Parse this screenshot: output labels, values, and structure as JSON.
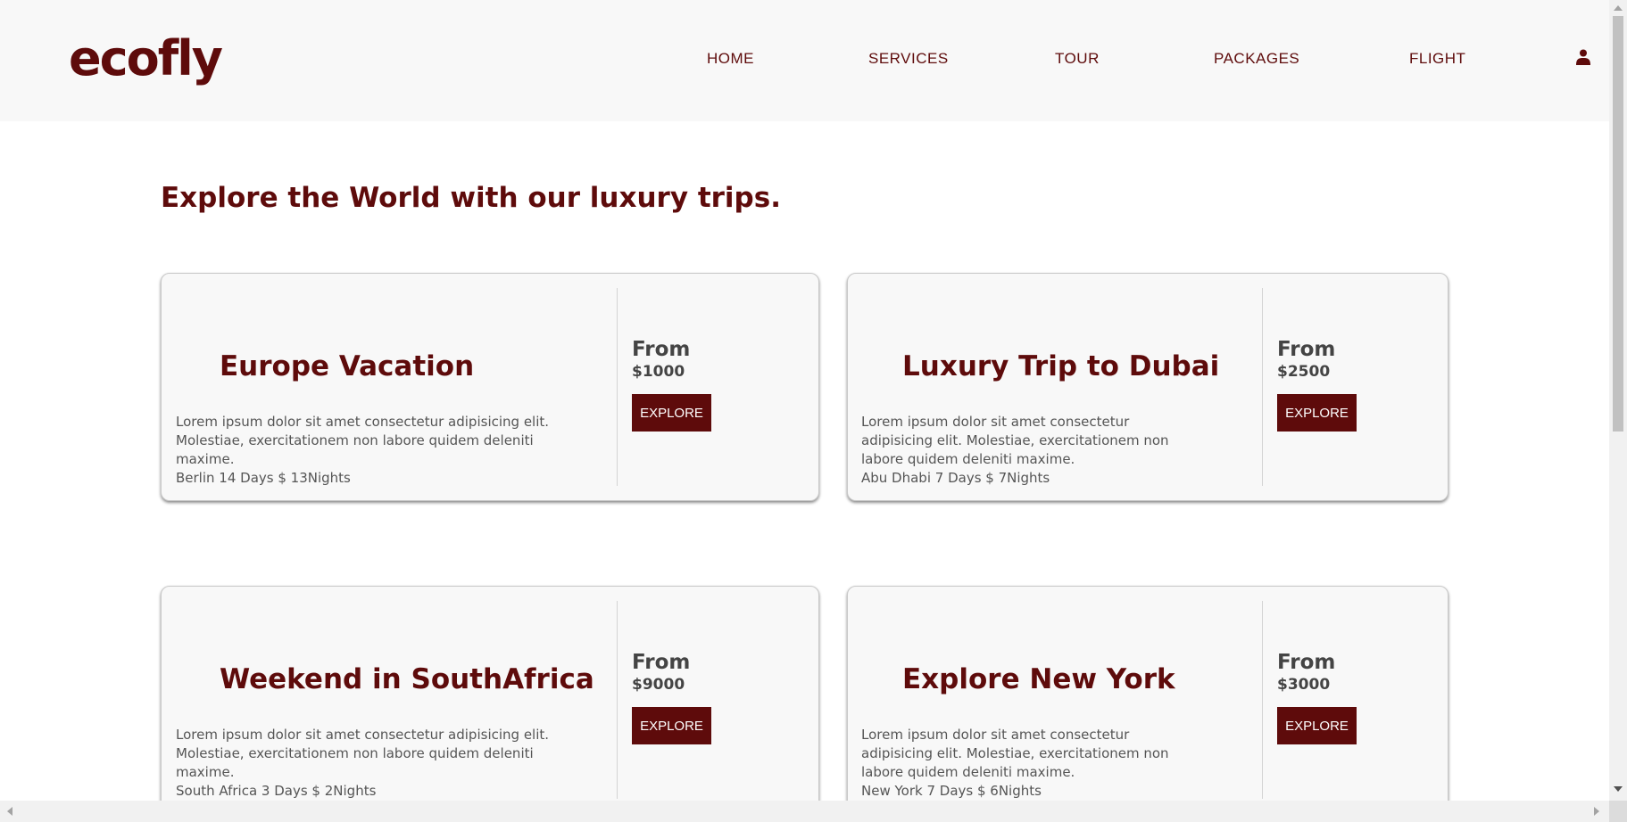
{
  "brand": {
    "logo": "ecofly"
  },
  "nav": {
    "items": [
      {
        "label": "HOME"
      },
      {
        "label": "SERVICES"
      },
      {
        "label": "TOUR"
      },
      {
        "label": "PACKAGES"
      },
      {
        "label": "FLIGHT"
      }
    ],
    "user_icon": "user-icon"
  },
  "main": {
    "title": "Explore the World with our luxury trips."
  },
  "trips": [
    {
      "title": "Europe Vacation",
      "desc_lines": [
        "Lorem ipsum dolor sit amet consectetur adipisicing elit.",
        "Molestiae, exercitationem non labore quidem deleniti",
        "maxime."
      ],
      "meta": "Berlin 14 Days $ 13Nights",
      "from_label": "From",
      "price": "$1000",
      "button": "EXPLORE"
    },
    {
      "title": "Luxury Trip to Dubai",
      "desc_lines": [
        "Lorem ipsum dolor sit amet consectetur",
        "adipisicing elit. Molestiae, exercitationem non",
        "labore quidem deleniti maxime."
      ],
      "meta": "Abu Dhabi 7 Days $ 7Nights",
      "from_label": "From",
      "price": "$2500",
      "button": "EXPLORE"
    },
    {
      "title": "Weekend in SouthAfrica",
      "desc_lines": [
        "Lorem ipsum dolor sit amet consectetur adipisicing elit.",
        "Molestiae, exercitationem non labore quidem deleniti",
        "maxime."
      ],
      "meta": "South Africa 3 Days $ 2Nights",
      "from_label": "From",
      "price": "$9000",
      "button": "EXPLORE"
    },
    {
      "title": "Explore New York",
      "desc_lines": [
        "Lorem ipsum dolor sit amet consectetur",
        "adipisicing elit. Molestiae, exercitationem non",
        "labore quidem deleniti maxime."
      ],
      "meta": "New York 7 Days $ 6Nights",
      "from_label": "From",
      "price": "$3000",
      "button": "EXPLORE"
    }
  ],
  "colors": {
    "brand": "#5e0b0b",
    "header_bg": "#f8f8f8",
    "card_bg": "#f8f8f8",
    "text_muted": "#555555"
  }
}
